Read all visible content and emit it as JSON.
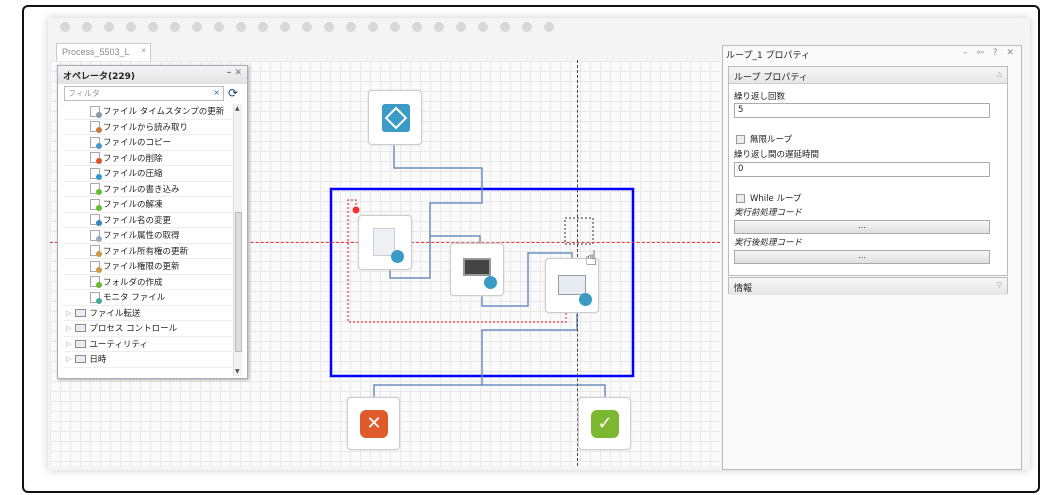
{
  "tab": {
    "label": "Process_5503_L",
    "close": "×"
  },
  "operators": {
    "title": "オペレータ(229)",
    "filter_placeholder": "フィルタ",
    "clear": "×",
    "refresh": "⟳",
    "minimize": "–",
    "close": "✕",
    "items": [
      {
        "label": "ファイル タイムスタンプの更新",
        "badge": "#8899aa"
      },
      {
        "label": "ファイルから読み取り",
        "badge": "#cc7733"
      },
      {
        "label": "ファイルのコピー",
        "badge": "#4499cc"
      },
      {
        "label": "ファイルの削除",
        "badge": "#dd5522"
      },
      {
        "label": "ファイルの圧縮",
        "badge": "#3399cc"
      },
      {
        "label": "ファイルの書き込み",
        "badge": "#66bb33"
      },
      {
        "label": "ファイルの解凍",
        "badge": "#66bb33"
      },
      {
        "label": "ファイル名の変更",
        "badge": "#3388bb"
      },
      {
        "label": "ファイル属性の取得",
        "badge": "#99aabb"
      },
      {
        "label": "ファイル所有権の更新",
        "badge": "#cc9944"
      },
      {
        "label": "ファイル権限の更新",
        "badge": "#cc9944"
      },
      {
        "label": "フォルダの作成",
        "badge": "#66bb33"
      },
      {
        "label": "モニタ ファイル",
        "badge": "#44aa99"
      }
    ],
    "folders": [
      "ファイル転送",
      "プロセス コントロール",
      "ユーティリティ",
      "日時"
    ]
  },
  "properties": {
    "title": "ループ_1 プロパティ",
    "controls": "– ⇦ ? ✕",
    "section": "ループ プロパティ",
    "repeat_count_label": "繰り返し回数",
    "repeat_count": "5",
    "infinite_loop": "無限ループ",
    "delay_label": "繰り返し間の遅延時間",
    "delay": "0",
    "while_loop": "While ループ",
    "pre_code_label": "実行前処理コード",
    "pre_code_btn": "...",
    "post_code_label": "実行後処理コード",
    "post_code_btn": "...",
    "info_section": "情報"
  },
  "colors": {
    "loop_border": "#0000ff",
    "guide_red": "#ee3333",
    "start": "#3a9cc4",
    "error": "#e05a2b",
    "success": "#7cb82f"
  }
}
